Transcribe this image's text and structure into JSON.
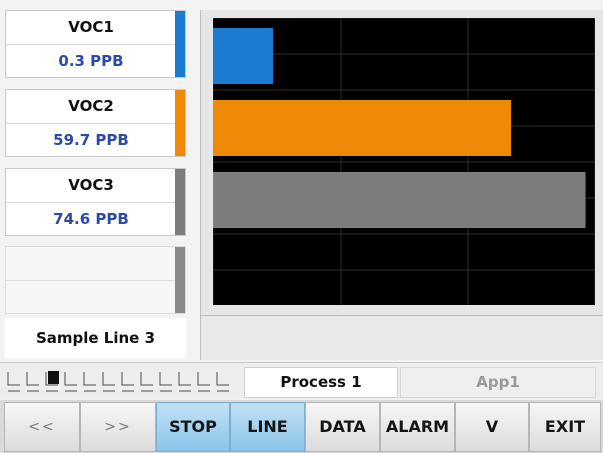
{
  "sensors": [
    {
      "name": "VOC1",
      "value": "0.3 PPB",
      "color": "#1b7ccf"
    },
    {
      "name": "VOC2",
      "value": "59.7 PPB",
      "color": "#ef8a08"
    },
    {
      "name": "VOC3",
      "value": "74.6 PPB",
      "color": "#7d7d7d"
    }
  ],
  "sample_line": "Sample Line 3",
  "chart_data": {
    "type": "bar",
    "orientation": "horizontal",
    "categories": [
      "VOC1",
      "VOC2",
      "VOC3"
    ],
    "values": [
      0.3,
      59.7,
      74.6
    ],
    "units": "PPB",
    "title": "",
    "xlabel": "",
    "ylabel": "",
    "grid": true,
    "background": "#000000"
  },
  "tabs": {
    "process": "Process 1",
    "app": "App1"
  },
  "toolbar": {
    "prev": "<<",
    "next": ">>",
    "stop": "STOP",
    "line": "LINE",
    "data": "DATA",
    "alarm": "ALARM",
    "v": "V",
    "exit": "EXIT"
  }
}
